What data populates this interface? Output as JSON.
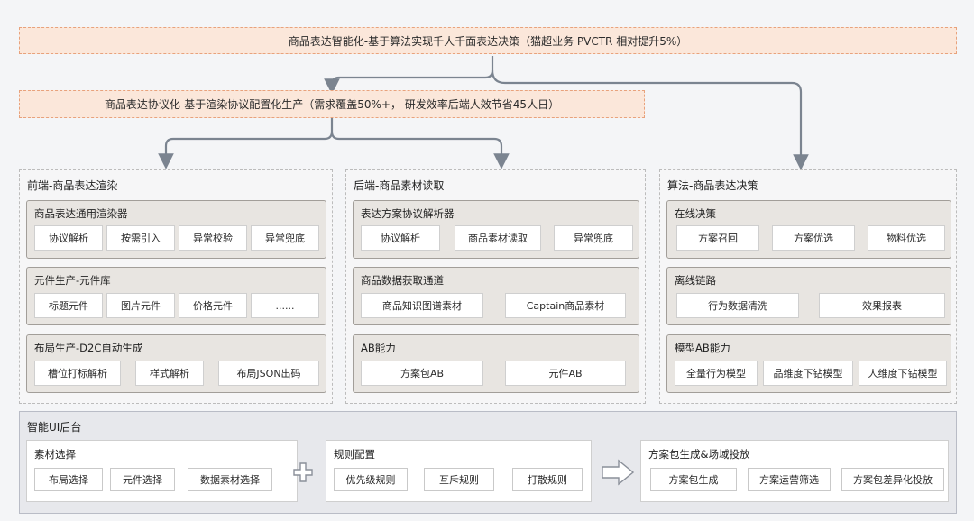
{
  "top_banner": "商品表达智能化-基于算法实现千人千面表达决策（猫超业务 PVCTR 相对提升5%）",
  "second_banner": "商品表达协议化-基于渲染协议配置化生产（需求覆盖50%+， 研发效率后端人效节省45人日）",
  "columns": [
    {
      "title": "前端-商品表达渲染",
      "groups": [
        {
          "title": "商品表达通用渲染器",
          "items": [
            "协议解析",
            "按需引入",
            "异常校验",
            "异常兜底"
          ]
        },
        {
          "title": "元件生产-元件库",
          "items": [
            "标题元件",
            "图片元件",
            "价格元件",
            "......"
          ]
        },
        {
          "title": "布局生产-D2C自动生成",
          "items": [
            "槽位打标解析",
            "样式解析",
            "布局JSON出码"
          ]
        }
      ]
    },
    {
      "title": "后端-商品素材读取",
      "groups": [
        {
          "title": "表达方案协议解析器",
          "items": [
            "协议解析",
            "商品素材读取",
            "异常兜底"
          ]
        },
        {
          "title": "商品数据获取通道",
          "items": [
            "商品知识图谱素材",
            "Captain商品素材"
          ]
        },
        {
          "title": "AB能力",
          "items": [
            "方案包AB",
            "元件AB"
          ]
        }
      ]
    },
    {
      "title": "算法-商品表达决策",
      "groups": [
        {
          "title": "在线决策",
          "items": [
            "方案召回",
            "方案优选",
            "物料优选"
          ]
        },
        {
          "title": "离线链路",
          "items": [
            "行为数据清洗",
            "效果报表"
          ]
        },
        {
          "title": "模型AB能力",
          "items": [
            "全量行为模型",
            "品维度下钻模型",
            "人维度下钻模型"
          ]
        }
      ]
    }
  ],
  "backend": {
    "title": "智能UI后台",
    "groups": [
      {
        "title": "素材选择",
        "items": [
          "布局选择",
          "元件选择",
          "数据素材选择"
        ]
      },
      {
        "title": "规则配置",
        "items": [
          "优先级规则",
          "互斥规则",
          "打散规则"
        ]
      },
      {
        "title": "方案包生成&场域投放",
        "items": [
          "方案包生成",
          "方案运营筛选",
          "方案包差异化投放"
        ]
      }
    ],
    "plus_icon": "plus-icon",
    "arrow_icon": "arrow-right-icon"
  },
  "colors": {
    "banner_fill": "#fbe7da",
    "banner_border": "#e8a27c",
    "connector": "#7b8490"
  }
}
